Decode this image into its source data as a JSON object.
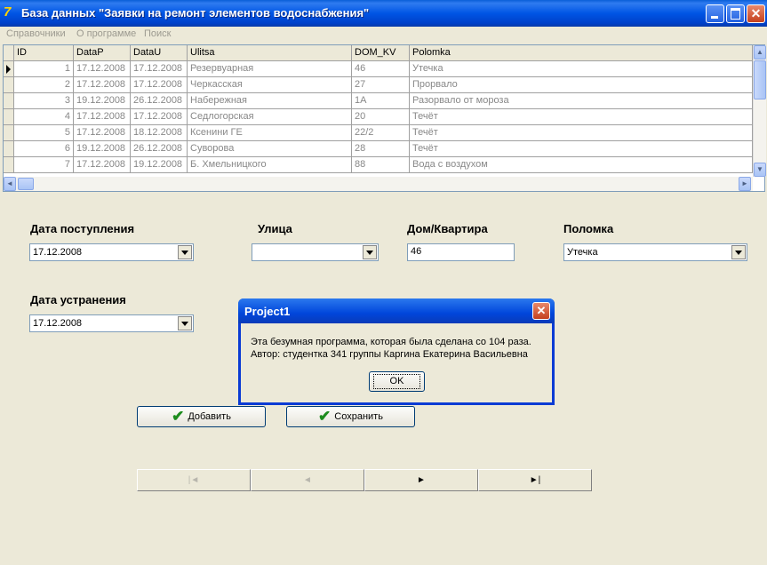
{
  "window": {
    "title": "База данных \"Заявки на ремонт элементов водоснабжения\"",
    "icon": "app-icon"
  },
  "menu": [
    "Справочники",
    "О программе",
    "Поиск"
  ],
  "grid": {
    "columns": [
      "ID",
      "DataP",
      "DataU",
      "Ulitsa",
      "DOM_KV",
      "Polomka"
    ],
    "rows": [
      [
        "1",
        "17.12.2008",
        "17.12.2008",
        "Резервуарная",
        "46",
        "Утечка"
      ],
      [
        "2",
        "17.12.2008",
        "17.12.2008",
        "Черкасская",
        "27",
        "Прорвало"
      ],
      [
        "3",
        "19.12.2008",
        "26.12.2008",
        "Набережная",
        "1А",
        "Разорвало от мороза"
      ],
      [
        "4",
        "17.12.2008",
        "17.12.2008",
        "Седлогорская",
        "20",
        "Течёт"
      ],
      [
        "5",
        "17.12.2008",
        "18.12.2008",
        "Ксенини ГЕ",
        "22/2",
        "Течёт"
      ],
      [
        "6",
        "19.12.2008",
        "26.12.2008",
        "Суворова",
        "28",
        "Течёт"
      ],
      [
        "7",
        "17.12.2008",
        "19.12.2008",
        "Б. Хмельницкого",
        "88",
        "Вода с воздухом"
      ]
    ]
  },
  "form": {
    "date_in_label": "Дата поступления",
    "date_in_value": "17.12.2008",
    "street_label": "Улица",
    "street_value": "",
    "house_label": "Дом/Квартира",
    "house_value": "46",
    "fault_label": "Поломка",
    "fault_value": "Утечка",
    "date_fix_label": "Дата устранения",
    "date_fix_value": "17.12.2008"
  },
  "buttons": {
    "add": "Добавить",
    "save": "Сохранить"
  },
  "nav": {
    "first": "|◄",
    "prev": "◄",
    "next": "►",
    "last": "►|"
  },
  "dialog": {
    "title": "Project1",
    "line1": "Эта безумная программа, которая была сделана со 104 раза.",
    "line2": "Автор: студентка 341 группы Каргина Екатерина Васильевна",
    "ok": "OK"
  }
}
